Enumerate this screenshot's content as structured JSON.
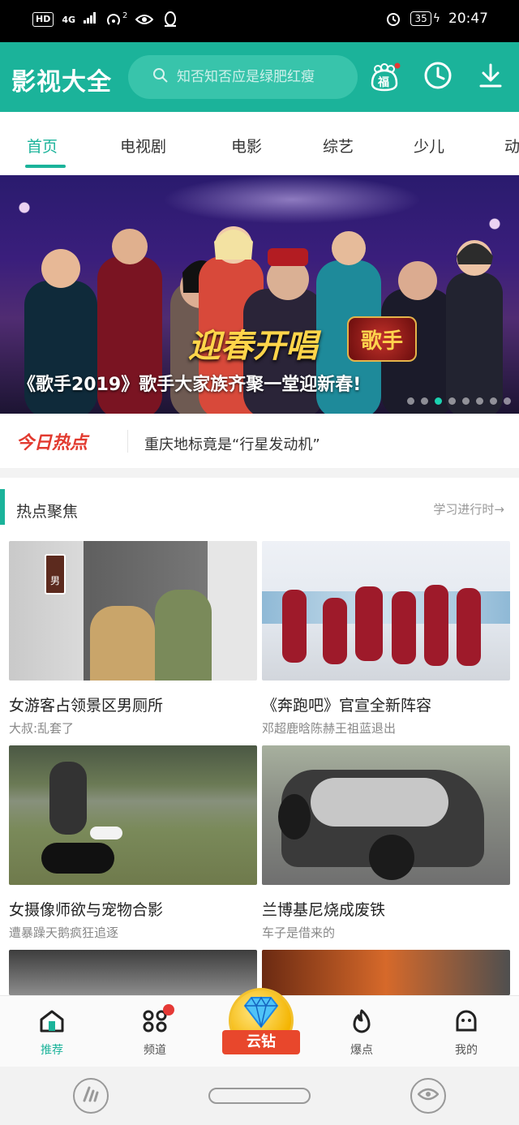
{
  "status_bar": {
    "left_chip": "HD",
    "network": "4G",
    "notif_count": "2",
    "battery": "35",
    "time": "20:47"
  },
  "header": {
    "app_title": "影视大全",
    "search_placeholder": "知否知否应是绿肥红瘦",
    "fu_badge": "福"
  },
  "tabs": [
    "首页",
    "电视剧",
    "电影",
    "综艺",
    "少儿",
    "动"
  ],
  "banner": {
    "title": "《歌手2019》歌手大家族齐聚一堂迎新春!",
    "art_text": "迎春开唱",
    "logo_text": "歌手",
    "dot_count": 8,
    "active_dot": 2
  },
  "hot_today": {
    "label": "今日热点",
    "headline": "重庆地标竟是“行星发动机”"
  },
  "section": {
    "title": "热点聚焦",
    "more": "学习进行时→"
  },
  "cards": [
    {
      "title": "女游客占领景区男厕所",
      "subtitle": "大叔:乱套了",
      "sign": "男"
    },
    {
      "title": "《奔跑吧》官宣全新阵容",
      "subtitle": "邓超鹿晗陈赫王祖蓝退出"
    },
    {
      "title": "女摄像师欲与宠物合影",
      "subtitle": "遭暴躁天鹅疯狂追逐"
    },
    {
      "title": "兰博基尼烧成废铁",
      "subtitle": "车子是借来的"
    }
  ],
  "tabbar": {
    "items": [
      "推荐",
      "频道",
      "云钻",
      "爆点",
      "我的"
    ]
  },
  "colors": {
    "brand": "#1bb39a",
    "hot_red": "#e23a2f"
  }
}
